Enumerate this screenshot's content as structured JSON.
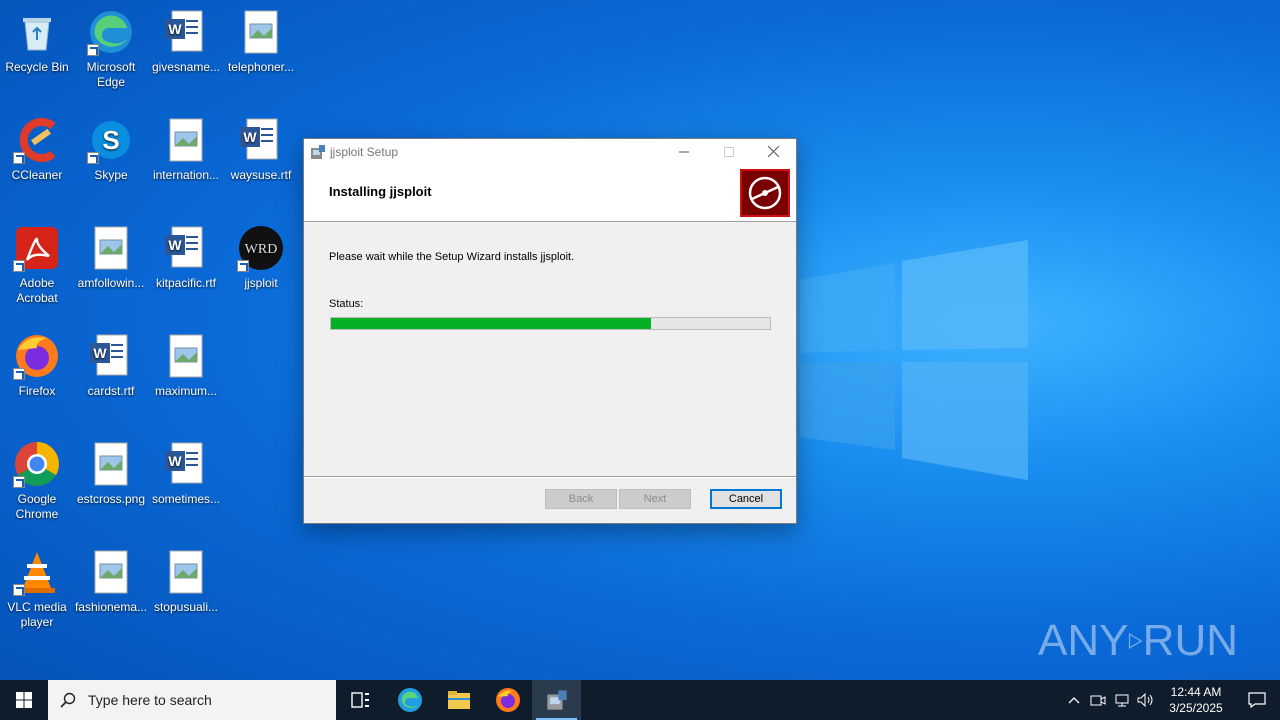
{
  "desktop": {
    "icons": [
      {
        "label": "Recycle Bin",
        "icon": "recycle-bin-icon"
      },
      {
        "label": "Microsoft Edge",
        "icon": "edge-icon"
      },
      {
        "label": "givesname...",
        "icon": "word-doc-icon"
      },
      {
        "label": "telephoner...",
        "icon": "image-file-icon"
      },
      {
        "label": "CCleaner",
        "icon": "ccleaner-icon"
      },
      {
        "label": "Skype",
        "icon": "skype-icon"
      },
      {
        "label": "internation...",
        "icon": "image-file-icon"
      },
      {
        "label": "waysuse.rtf",
        "icon": "word-doc-icon"
      },
      {
        "label": "Adobe Acrobat",
        "icon": "acrobat-icon"
      },
      {
        "label": "amfollowin...",
        "icon": "image-file-icon"
      },
      {
        "label": "kitpacific.rtf",
        "icon": "word-doc-icon"
      },
      {
        "label": "jjsploit",
        "icon": "jjsploit-icon"
      },
      {
        "label": "Firefox",
        "icon": "firefox-icon"
      },
      {
        "label": "cardst.rtf",
        "icon": "word-doc-icon"
      },
      {
        "label": "maximum...",
        "icon": "image-file-icon"
      },
      {
        "label": "Google Chrome",
        "icon": "chrome-icon"
      },
      {
        "label": "estcross.png",
        "icon": "image-file-icon"
      },
      {
        "label": "sometimes...",
        "icon": "word-doc-icon"
      },
      {
        "label": "VLC media player",
        "icon": "vlc-icon"
      },
      {
        "label": "fashionema...",
        "icon": "image-file-icon"
      },
      {
        "label": "stopusuali...",
        "icon": "image-file-icon"
      }
    ]
  },
  "dialog": {
    "window_title": "jjsploit Setup",
    "header_title": "Installing jjsploit",
    "message": "Please wait while the Setup Wizard installs jjsploit.",
    "status_label": "Status:",
    "progress_fraction": 0.73,
    "buttons": {
      "back": "Back",
      "next": "Next",
      "cancel": "Cancel"
    },
    "colors": {
      "progress": "#06b025",
      "banner": "#7a0000"
    }
  },
  "taskbar": {
    "search_placeholder": "Type here to search",
    "apps": [
      "task-view-icon",
      "edge-icon",
      "file-explorer-icon",
      "firefox-icon",
      "installer-icon"
    ],
    "clock_time": "12:44 AM",
    "clock_date": "3/25/2025"
  },
  "watermark": {
    "left": "ANY",
    "right": "RUN"
  }
}
